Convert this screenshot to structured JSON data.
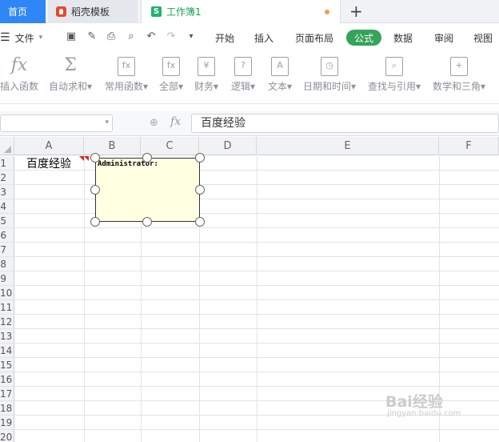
{
  "tabs": {
    "home": "首页",
    "template": "稻壳模板",
    "workbook": "工作簿1",
    "workbook_icon": "S",
    "plus": "+"
  },
  "menu": {
    "file": "文件",
    "start": "开始",
    "insert": "插入",
    "layout": "页面布局",
    "formula": "公式",
    "data": "数据",
    "review": "审阅",
    "view": "视图"
  },
  "ribbon": [
    {
      "label": "插入函数",
      "icon": "fx"
    },
    {
      "label": "自动求和",
      "icon": "Σ"
    },
    {
      "label": "常用函数",
      "icon": "fx"
    },
    {
      "label": "全部",
      "icon": "fx"
    },
    {
      "label": "财务",
      "icon": "¥"
    },
    {
      "label": "逻辑",
      "icon": "?"
    },
    {
      "label": "文本",
      "icon": "A"
    },
    {
      "label": "日期和时间",
      "icon": "◷"
    },
    {
      "label": "查找与引用",
      "icon": "⌕"
    },
    {
      "label": "数学和三角",
      "icon": "+"
    }
  ],
  "formula_bar": {
    "fx": "fx",
    "content": "百度经验"
  },
  "columns": [
    "A",
    "B",
    "C",
    "D",
    "E",
    "F"
  ],
  "rows": [
    "1",
    "2",
    "3",
    "4",
    "5",
    "6",
    "7",
    "8",
    "9",
    "10",
    "11",
    "12",
    "13",
    "14",
    "15",
    "16",
    "17",
    "18",
    "19",
    "20"
  ],
  "cell_a1": "百度经验",
  "comment": {
    "author": "Administrator:"
  },
  "watermark": {
    "main": "Bai经验",
    "sub": "jingyan.baidu.com"
  }
}
